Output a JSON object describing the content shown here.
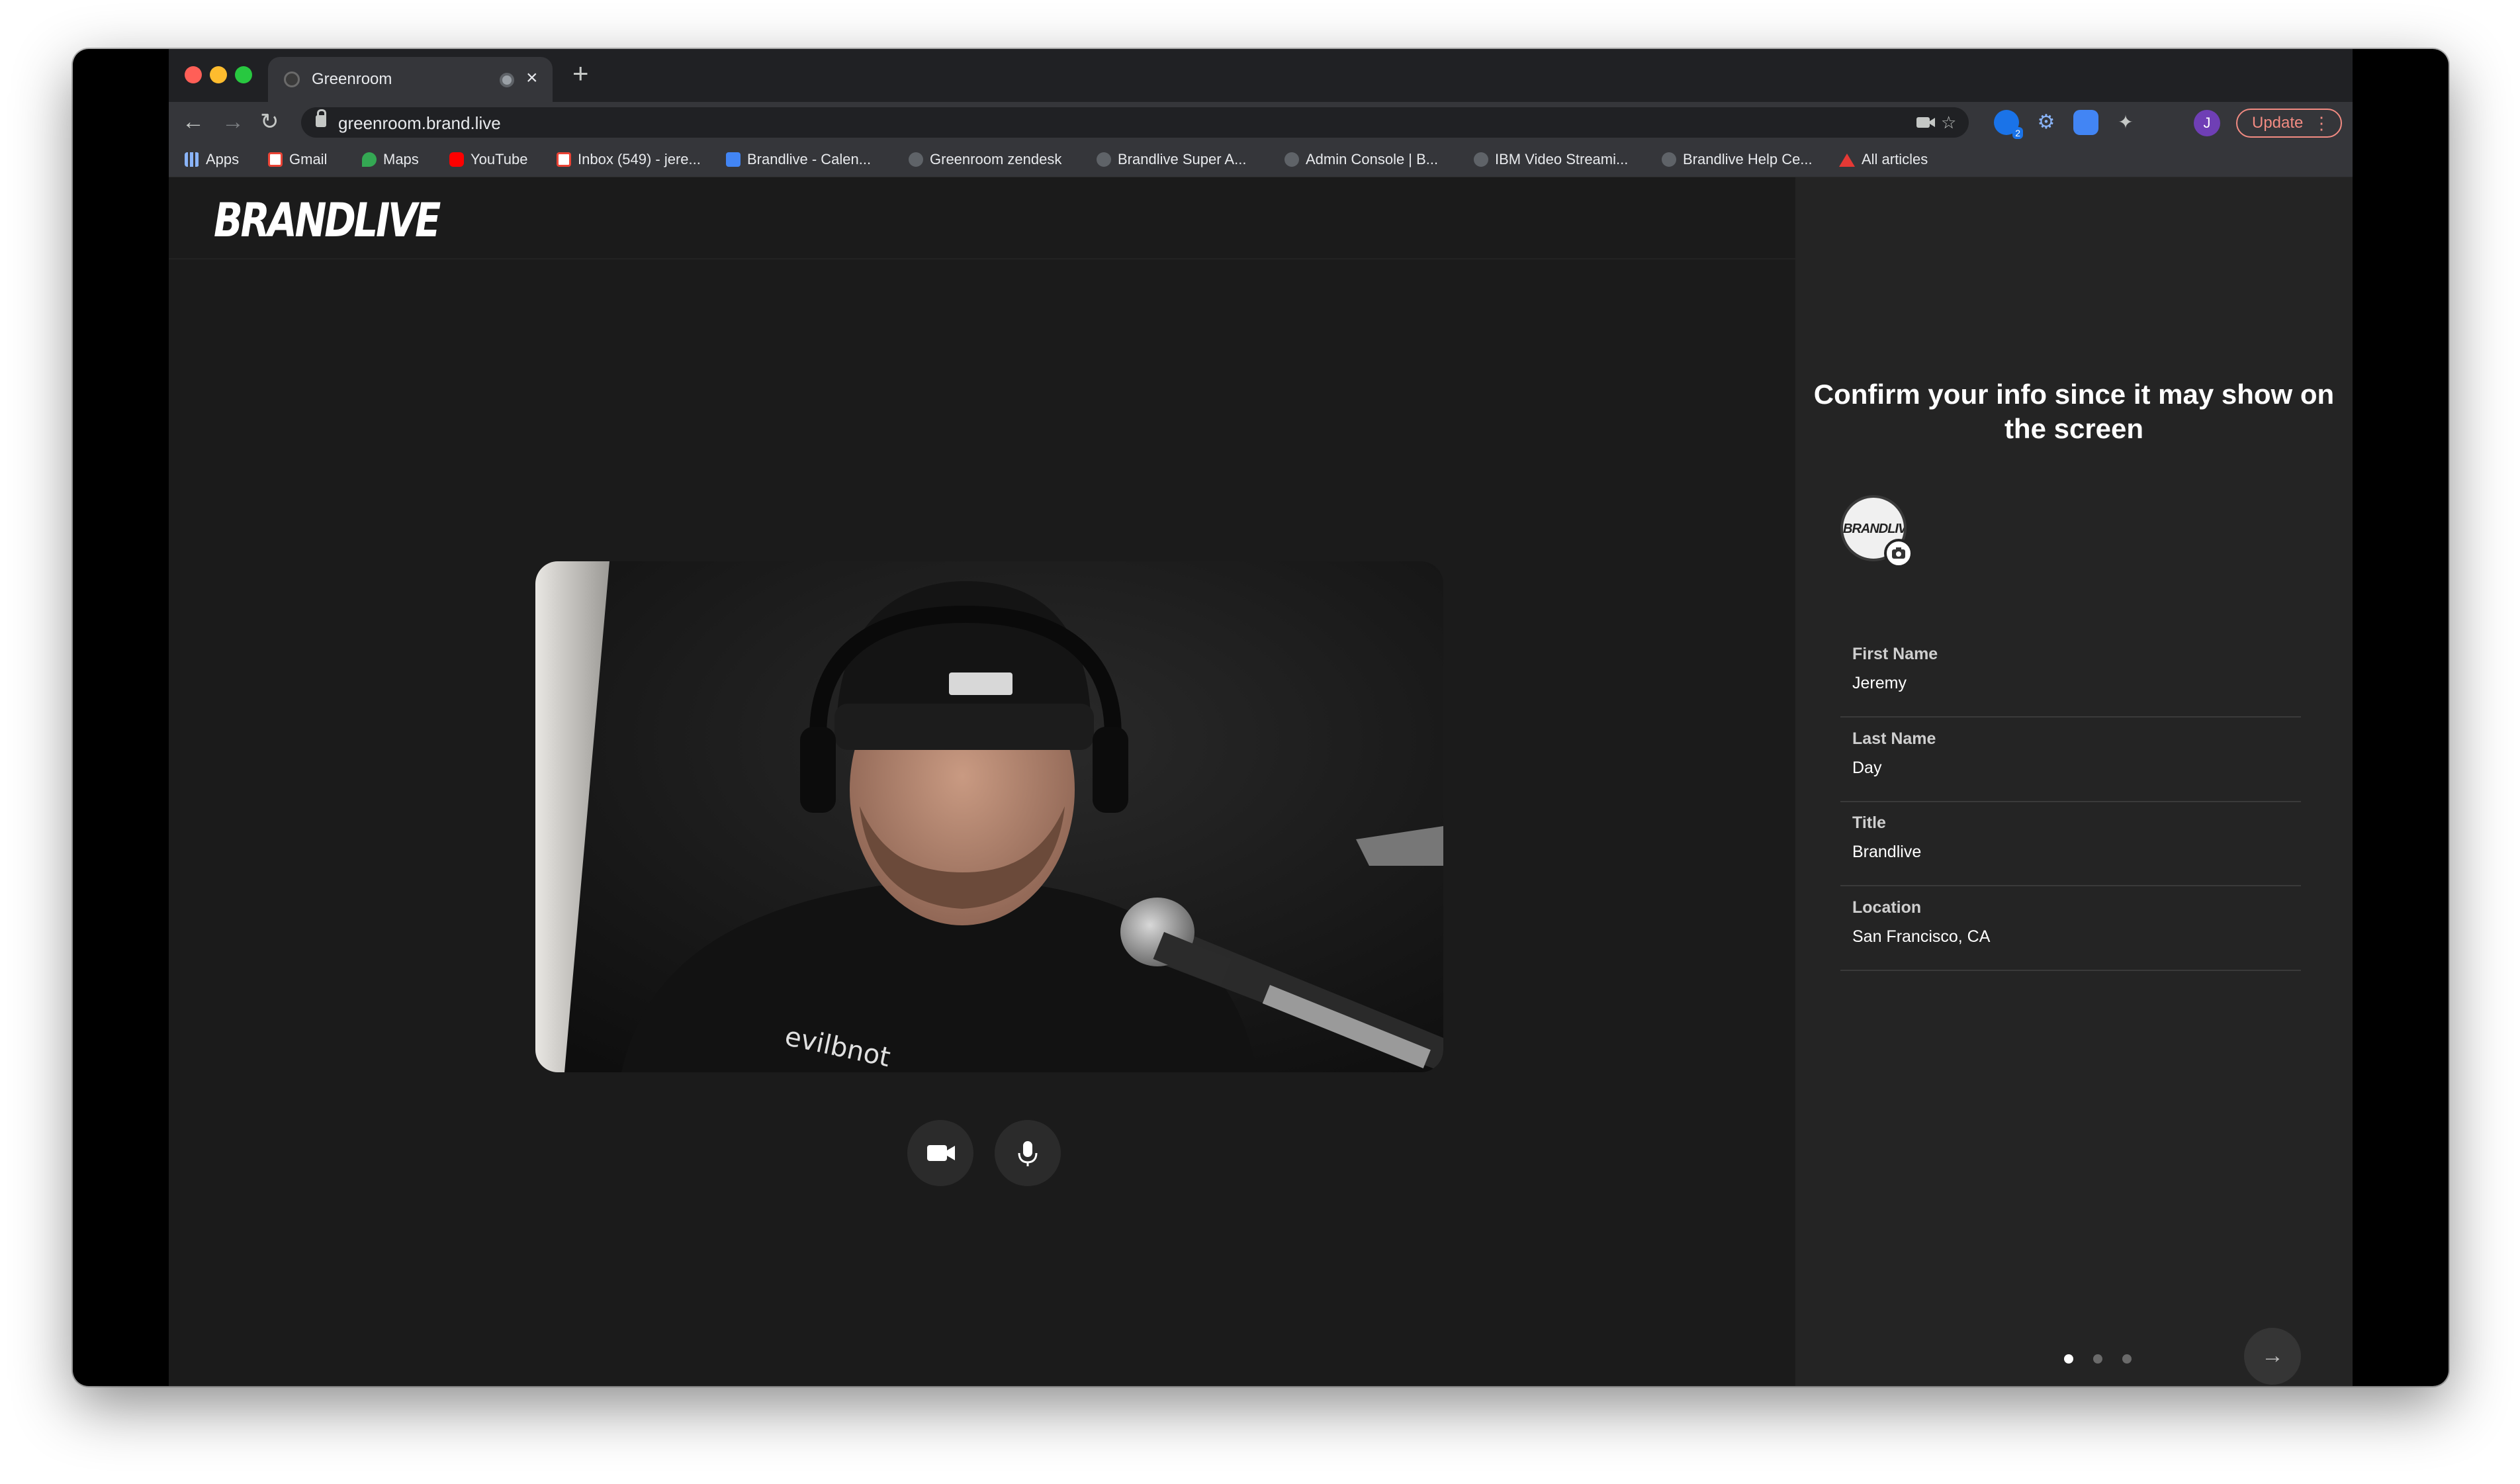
{
  "browser": {
    "tab": {
      "title": "Greenroom"
    },
    "url": "greenroom.brand.live",
    "update_label": "Update",
    "profile_initial": "J",
    "extension_badge": "2",
    "bookmarks": [
      {
        "label": "Apps",
        "icon": "apps-grid-icon",
        "color": "#8ab4f8"
      },
      {
        "label": "Gmail",
        "icon": "gmail-icon",
        "color": "#ea4335"
      },
      {
        "label": "Maps",
        "icon": "maps-pin-icon",
        "color": "#34a853"
      },
      {
        "label": "YouTube",
        "icon": "youtube-icon",
        "color": "#ff0000"
      },
      {
        "label": "Inbox (549) - jere...",
        "icon": "gmail-icon",
        "color": "#ea4335"
      },
      {
        "label": "Brandlive - Calen...",
        "icon": "calendar-icon",
        "color": "#4285f4"
      },
      {
        "label": "Greenroom zendesk",
        "icon": "globe-icon",
        "color": "#5f6368"
      },
      {
        "label": "Brandlive Super A...",
        "icon": "globe-icon",
        "color": "#5f6368"
      },
      {
        "label": "Admin Console | B...",
        "icon": "globe-icon",
        "color": "#5f6368"
      },
      {
        "label": "IBM Video Streami...",
        "icon": "globe-icon",
        "color": "#5f6368"
      },
      {
        "label": "Brandlive Help Ce...",
        "icon": "globe-icon",
        "color": "#5f6368"
      },
      {
        "label": "All articles",
        "icon": "articles-icon",
        "color": "#e53935"
      }
    ]
  },
  "app": {
    "logo": "BRANDLIVE",
    "avatar_text": "BRANDLIVE",
    "panel": {
      "title": "Confirm your info since it may show on the screen",
      "fields": [
        {
          "label": "First Name",
          "value": "Jeremy"
        },
        {
          "label": "Last Name",
          "value": "Day"
        },
        {
          "label": "Title",
          "value": "Brandlive"
        },
        {
          "label": "Location",
          "value": "San Francisco, CA"
        }
      ],
      "steps": {
        "total": 3,
        "current": 1
      }
    }
  },
  "colors": {
    "page_bg": "#1b1b1b",
    "panel_bg": "#242424",
    "accent_update": "#f28b82"
  }
}
